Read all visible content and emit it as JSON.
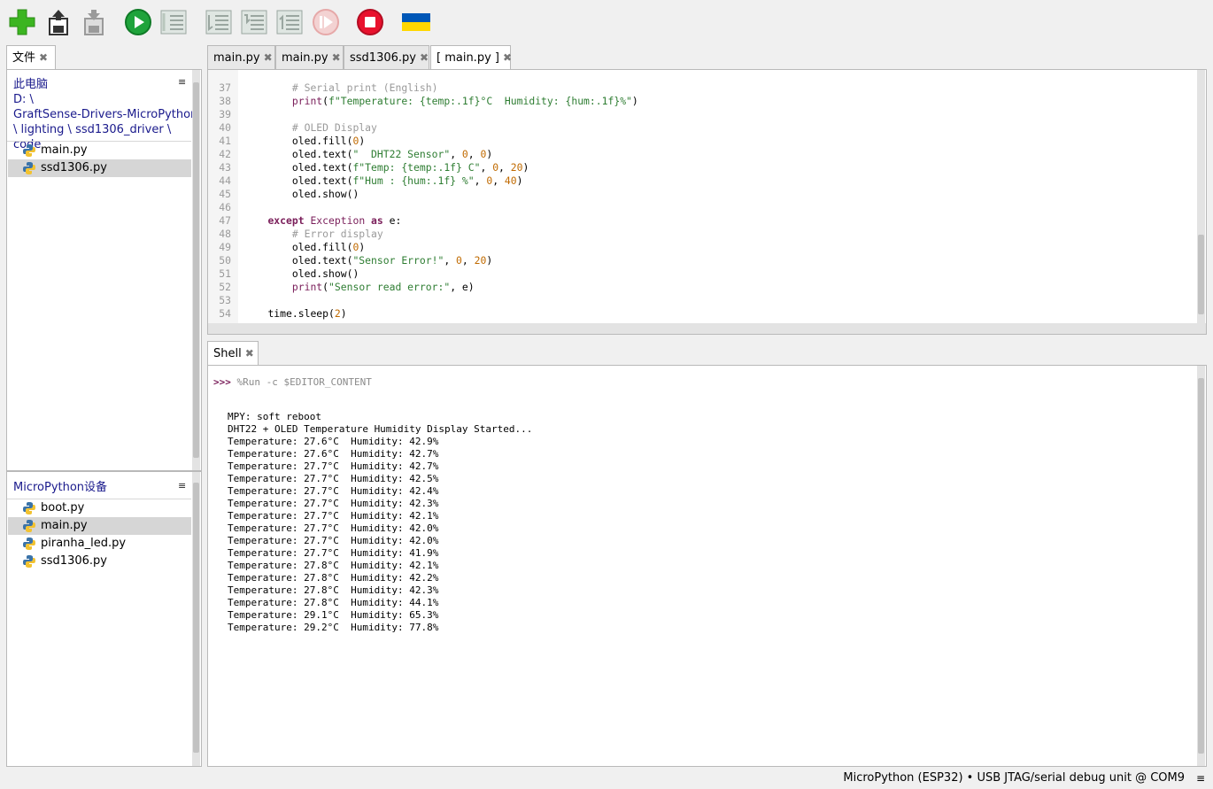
{
  "toolbar": {
    "buttons": [
      {
        "name": "new-file-icon",
        "color": "#3cb521"
      },
      {
        "name": "open-file-icon",
        "color": "#333333"
      },
      {
        "name": "save-file-icon",
        "color": "#9a9a9a"
      },
      {
        "name": "run-icon",
        "color": "#1fa33b"
      },
      {
        "name": "debug-icon",
        "color": "#9aa6a0"
      },
      {
        "name": "step-over-icon",
        "color": "#9aa6a0"
      },
      {
        "name": "step-into-icon",
        "color": "#9aa6a0"
      },
      {
        "name": "step-out-icon",
        "color": "#9aa6a0"
      },
      {
        "name": "resume-icon",
        "color": "#e6a8a8"
      },
      {
        "name": "stop-icon",
        "color": "#e8112d"
      },
      {
        "name": "ukraine-flag-icon",
        "color": "#0057b7"
      }
    ]
  },
  "files_panel": {
    "tab_label": "文件",
    "local": {
      "title": "此电脑",
      "path_lines": [
        "D: \\",
        "GraftSense-Drivers-MicroPython",
        "\\ lighting \\ ssd1306_driver \\ code"
      ],
      "files": [
        "main.py",
        "ssd1306.py"
      ],
      "selected_index": 1
    },
    "device": {
      "title": "MicroPython设备",
      "files": [
        "boot.py",
        "main.py",
        "piranha_led.py",
        "ssd1306.py"
      ],
      "selected_index": 1
    },
    "menu_glyph": "≡"
  },
  "editor": {
    "tabs": [
      "main.py",
      "main.py",
      "ssd1306.py",
      "[ main.py ]"
    ],
    "active_tab": 3,
    "close_glyph": "✖",
    "lines": [
      {
        "n": "37",
        "indent": "        ",
        "code": [
          [
            "cm",
            "# Serial print (English)"
          ]
        ]
      },
      {
        "n": "38",
        "indent": "        ",
        "code": [
          [
            "bi",
            "print"
          ],
          [
            "",
            "("
          ],
          [
            "str",
            "f\"Temperature: {temp:.1f}°C  Humidity: {hum:.1f}%\""
          ],
          [
            "",
            ")"
          ]
        ]
      },
      {
        "n": "39",
        "indent": "",
        "code": []
      },
      {
        "n": "40",
        "indent": "        ",
        "code": [
          [
            "cm",
            "# OLED Display"
          ]
        ]
      },
      {
        "n": "41",
        "indent": "        ",
        "code": [
          [
            "",
            "oled.fill("
          ],
          [
            "num",
            "0"
          ],
          [
            "",
            ")"
          ]
        ]
      },
      {
        "n": "42",
        "indent": "        ",
        "code": [
          [
            "",
            "oled.text("
          ],
          [
            "str",
            "\"  DHT22 Sensor\""
          ],
          [
            "",
            ", "
          ],
          [
            "num",
            "0"
          ],
          [
            "",
            ", "
          ],
          [
            "num",
            "0"
          ],
          [
            "",
            ")"
          ]
        ]
      },
      {
        "n": "43",
        "indent": "        ",
        "code": [
          [
            "",
            "oled.text("
          ],
          [
            "str",
            "f\"Temp: {temp:.1f} C\""
          ],
          [
            "",
            ", "
          ],
          [
            "num",
            "0"
          ],
          [
            "",
            ", "
          ],
          [
            "num",
            "20"
          ],
          [
            "",
            ")"
          ]
        ]
      },
      {
        "n": "44",
        "indent": "        ",
        "code": [
          [
            "",
            "oled.text("
          ],
          [
            "str",
            "f\"Hum : {hum:.1f} %\""
          ],
          [
            "",
            ", "
          ],
          [
            "num",
            "0"
          ],
          [
            "",
            ", "
          ],
          [
            "num",
            "40"
          ],
          [
            "",
            ")"
          ]
        ]
      },
      {
        "n": "45",
        "indent": "        ",
        "code": [
          [
            "",
            "oled.show()"
          ]
        ]
      },
      {
        "n": "46",
        "indent": "",
        "code": []
      },
      {
        "n": "47",
        "indent": "    ",
        "code": [
          [
            "kw",
            "except"
          ],
          [
            "",
            " "
          ],
          [
            "bi",
            "Exception"
          ],
          [
            "",
            " "
          ],
          [
            "kw",
            "as"
          ],
          [
            "",
            " e:"
          ]
        ]
      },
      {
        "n": "48",
        "indent": "        ",
        "code": [
          [
            "cm",
            "# Error display"
          ]
        ]
      },
      {
        "n": "49",
        "indent": "        ",
        "code": [
          [
            "",
            "oled.fill("
          ],
          [
            "num",
            "0"
          ],
          [
            "",
            ")"
          ]
        ]
      },
      {
        "n": "50",
        "indent": "        ",
        "code": [
          [
            "",
            "oled.text("
          ],
          [
            "str",
            "\"Sensor Error!\""
          ],
          [
            "",
            ", "
          ],
          [
            "num",
            "0"
          ],
          [
            "",
            ", "
          ],
          [
            "num",
            "20"
          ],
          [
            "",
            ")"
          ]
        ]
      },
      {
        "n": "51",
        "indent": "        ",
        "code": [
          [
            "",
            "oled.show()"
          ]
        ]
      },
      {
        "n": "52",
        "indent": "        ",
        "code": [
          [
            "bi",
            "print"
          ],
          [
            "",
            "("
          ],
          [
            "str",
            "\"Sensor read error:\""
          ],
          [
            "",
            ", e)"
          ]
        ]
      },
      {
        "n": "53",
        "indent": "",
        "code": []
      },
      {
        "n": "54",
        "indent": "    ",
        "code": [
          [
            "",
            "time.sleep("
          ],
          [
            "num",
            "2"
          ],
          [
            "",
            ")"
          ]
        ]
      }
    ]
  },
  "shell": {
    "tab_label": "Shell",
    "prompt": ">>>",
    "command": "%Run -c $EDITOR_CONTENT",
    "output": [
      "MPY: soft reboot",
      "DHT22 + OLED Temperature Humidity Display Started...",
      "Temperature: 27.6°C  Humidity: 42.9%",
      "Temperature: 27.6°C  Humidity: 42.7%",
      "Temperature: 27.7°C  Humidity: 42.7%",
      "Temperature: 27.7°C  Humidity: 42.5%",
      "Temperature: 27.7°C  Humidity: 42.4%",
      "Temperature: 27.7°C  Humidity: 42.3%",
      "Temperature: 27.7°C  Humidity: 42.1%",
      "Temperature: 27.7°C  Humidity: 42.0%",
      "Temperature: 27.7°C  Humidity: 42.0%",
      "Temperature: 27.7°C  Humidity: 41.9%",
      "Temperature: 27.8°C  Humidity: 42.1%",
      "Temperature: 27.8°C  Humidity: 42.2%",
      "Temperature: 27.8°C  Humidity: 42.3%",
      "Temperature: 27.8°C  Humidity: 44.1%",
      "Temperature: 29.1°C  Humidity: 65.3%",
      "Temperature: 29.2°C  Humidity: 77.8%"
    ]
  },
  "status_bar": {
    "text": "MicroPython (ESP32)  •  USB JTAG/serial debug unit @ COM9",
    "menu_glyph": "≡"
  }
}
